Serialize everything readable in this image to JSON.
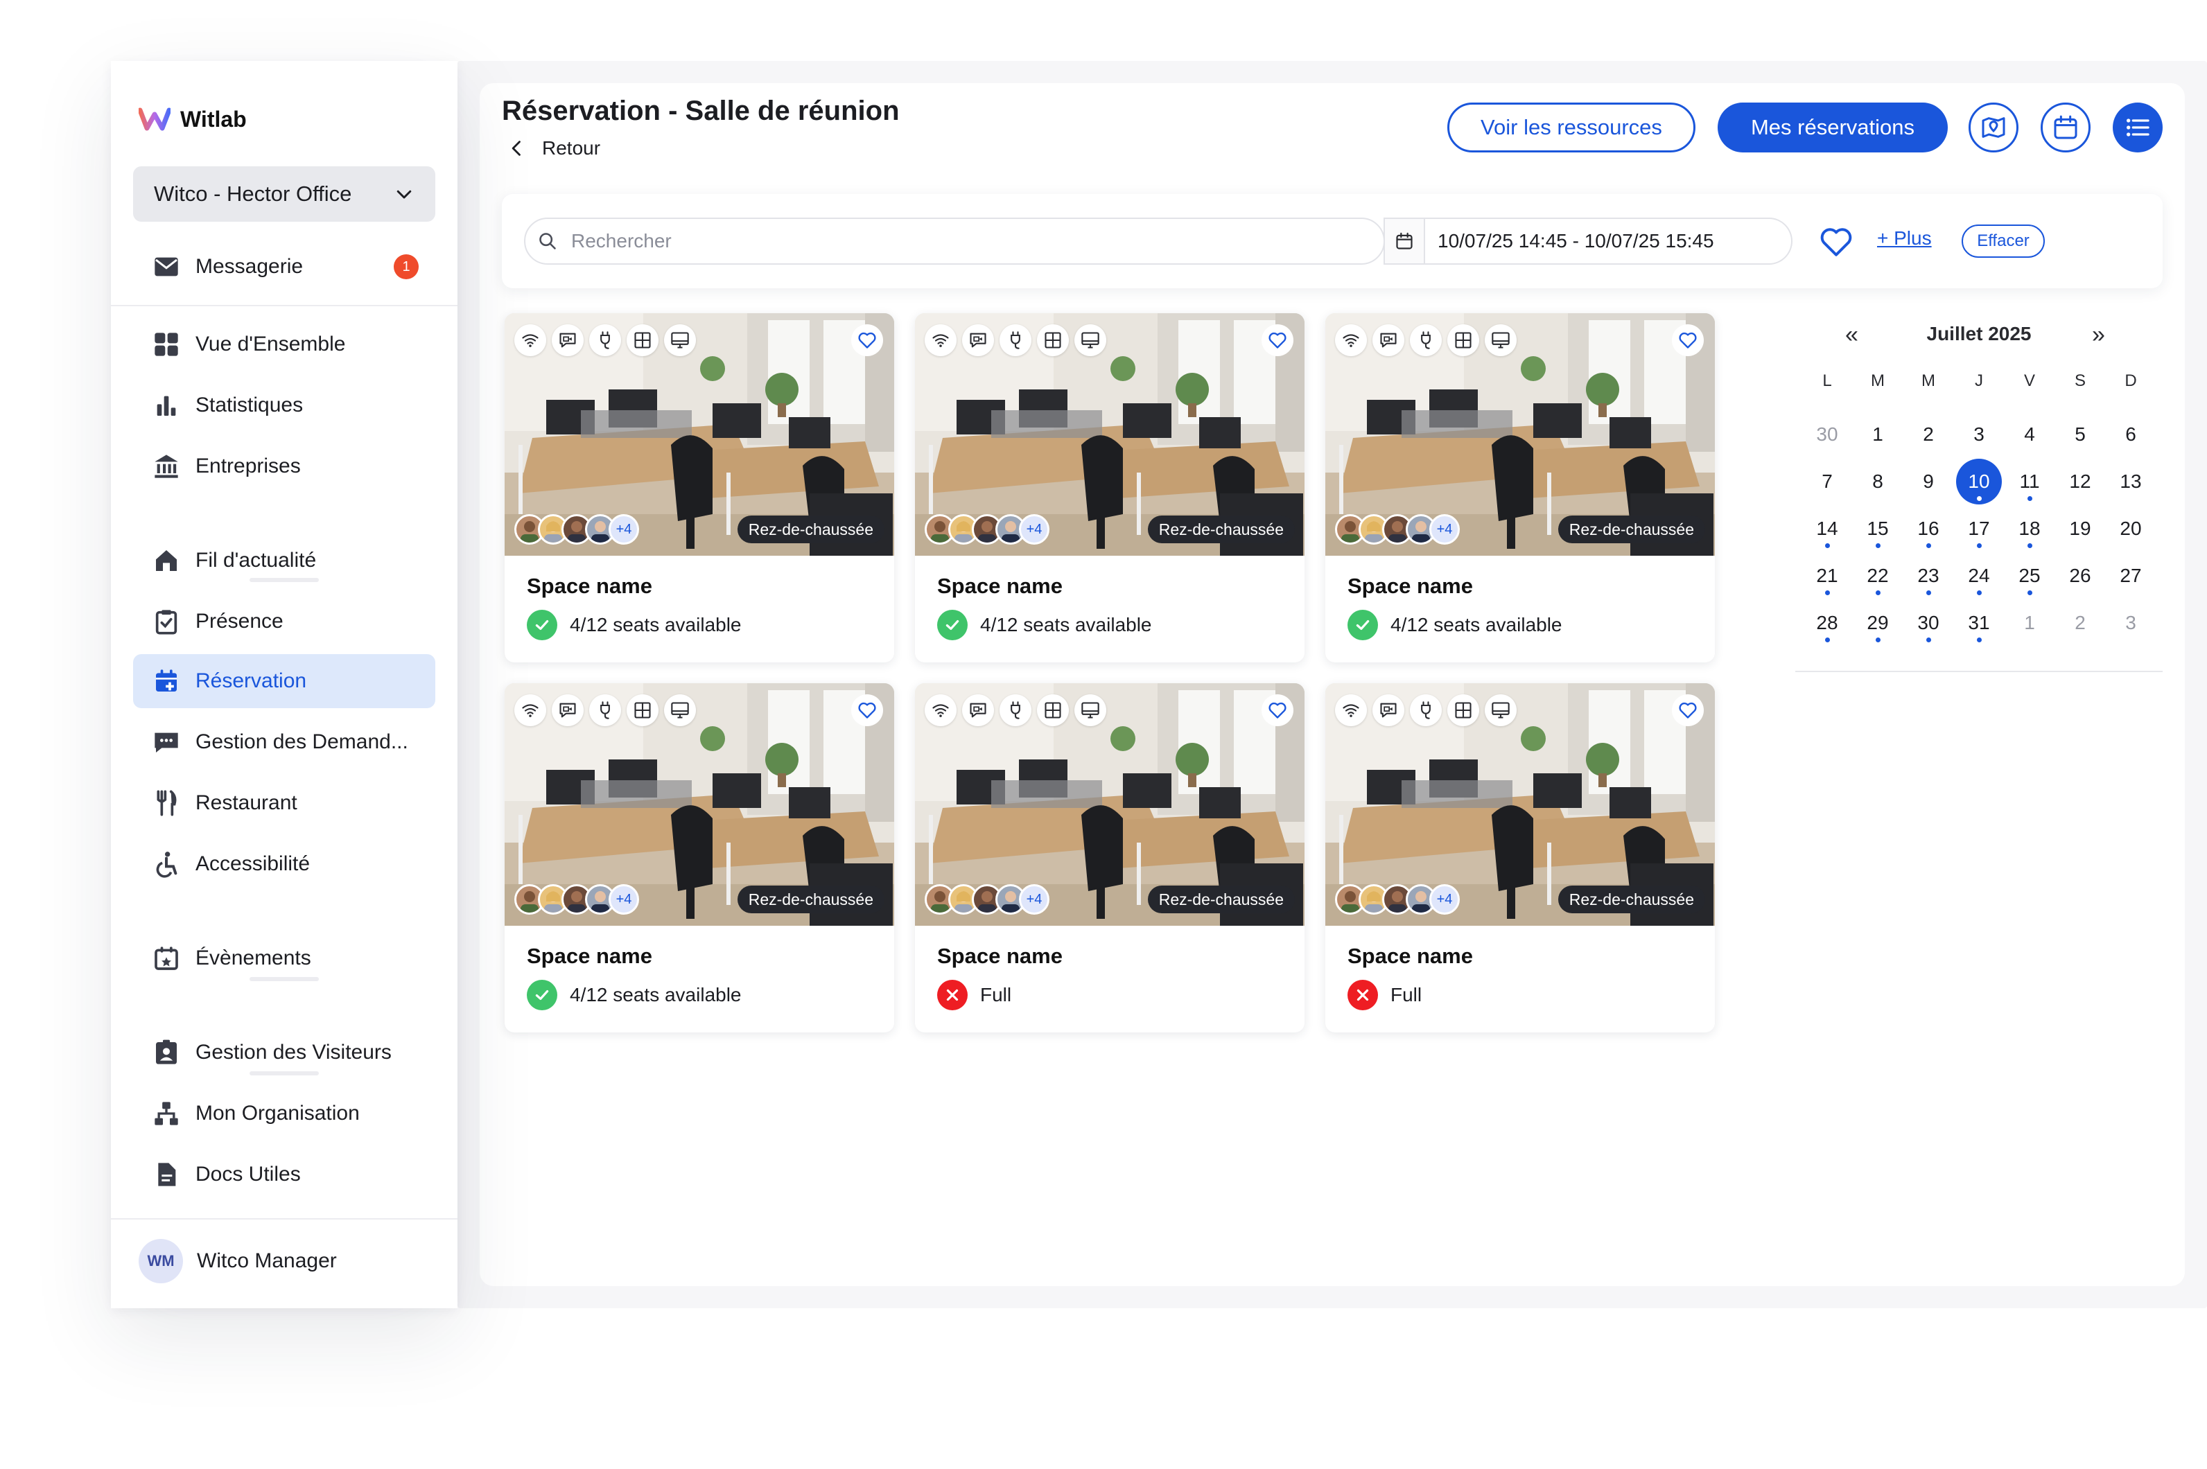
{
  "app": {
    "name": "Witlab"
  },
  "sidebar": {
    "office": "Witco - Hector Office",
    "items": [
      {
        "label": "Messagerie",
        "icon": "mail-icon",
        "badge": "1"
      },
      {
        "label": "Vue d'Ensemble",
        "icon": "grid-icon"
      },
      {
        "label": "Statistiques",
        "icon": "bar-chart-icon"
      },
      {
        "label": "Entreprises",
        "icon": "bank-icon"
      },
      {
        "label": "Fil d'actualité",
        "icon": "home-icon"
      },
      {
        "label": "Présence",
        "icon": "clipboard-check-icon"
      },
      {
        "label": "Réservation",
        "icon": "calendar-plus-icon",
        "active": true
      },
      {
        "label": "Gestion des Demand...",
        "icon": "message-icon"
      },
      {
        "label": "Restaurant",
        "icon": "cutlery-icon"
      },
      {
        "label": "Accessibilité",
        "icon": "accessibility-icon"
      },
      {
        "label": "Évènements",
        "icon": "calendar-star-icon"
      },
      {
        "label": "Gestion des Visiteurs",
        "icon": "visitor-badge-icon"
      },
      {
        "label": "Mon Organisation",
        "icon": "org-chart-icon"
      },
      {
        "label": "Docs Utiles",
        "icon": "document-icon"
      }
    ],
    "user": {
      "initials": "WM",
      "name": "Witco Manager"
    }
  },
  "header": {
    "title": "Réservation - Salle de réunion",
    "back_label": "Retour",
    "btn_resources": "Voir les ressources",
    "btn_my_reservations": "Mes réservations"
  },
  "filters": {
    "search_placeholder": "Rechercher",
    "date_range": "10/07/25 14:45 - 10/07/25 15:45",
    "more_label": "+ Plus",
    "clear_label": "Effacer"
  },
  "spaces": [
    {
      "name": "Space name",
      "floor": "Rez-de-chaussée",
      "extra": "+4",
      "status": "4/12 seats available",
      "available": true
    },
    {
      "name": "Space name",
      "floor": "Rez-de-chaussée",
      "extra": "+4",
      "status": "4/12 seats available",
      "available": true
    },
    {
      "name": "Space name",
      "floor": "Rez-de-chaussée",
      "extra": "+4",
      "status": "4/12 seats available",
      "available": true
    },
    {
      "name": "Space name",
      "floor": "Rez-de-chaussée",
      "extra": "+4",
      "status": "4/12 seats available",
      "available": true
    },
    {
      "name": "Space name",
      "floor": "Rez-de-chaussée",
      "extra": "+4",
      "status": "Full",
      "available": false
    },
    {
      "name": "Space name",
      "floor": "Rez-de-chaussée",
      "extra": "+4",
      "status": "Full",
      "available": false
    }
  ],
  "calendar": {
    "month": "Juillet 2025",
    "prev": "«",
    "next": "»",
    "weekdays": [
      "L",
      "M",
      "M",
      "J",
      "V",
      "S",
      "D"
    ],
    "weeks": [
      [
        "30",
        "1",
        "2",
        "3",
        "4",
        "5",
        "6"
      ],
      [
        "7",
        "8",
        "9",
        "10",
        "11",
        "12",
        "13"
      ],
      [
        "14",
        "15",
        "16",
        "17",
        "18",
        "19",
        "20"
      ],
      [
        "21",
        "22",
        "23",
        "24",
        "25",
        "26",
        "27"
      ],
      [
        "28",
        "29",
        "30",
        "31",
        "1",
        "2",
        "3"
      ]
    ],
    "selected": "10",
    "colors": {
      "accent": "#1a56db",
      "available": "#3fc46a",
      "full": "#ee1d23"
    }
  }
}
